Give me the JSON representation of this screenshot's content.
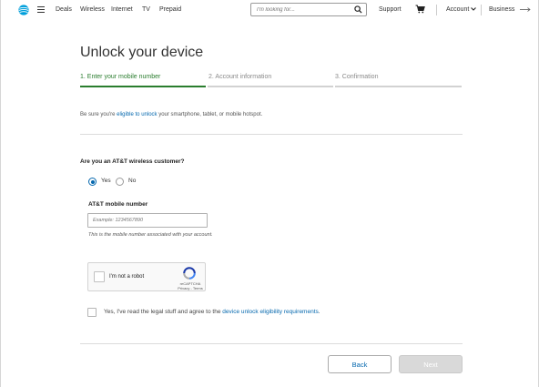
{
  "header": {
    "nav": [
      "Deals",
      "Wireless",
      "Internet",
      "TV",
      "Prepaid"
    ],
    "search_placeholder": "I'm looking for...",
    "support": "Support",
    "account": "Account",
    "business": "Business"
  },
  "page": {
    "title": "Unlock your device",
    "steps": [
      "1. Enter your mobile number",
      "2. Account information",
      "3. Confirmation"
    ],
    "active_step": 1,
    "intro_prefix": "Be sure you're ",
    "intro_link": "eligible to unlock",
    "intro_suffix": " your smartphone, tablet, or mobile hotspot."
  },
  "form": {
    "question": "Are you an AT&T wireless customer?",
    "yes_label": "Yes",
    "no_label": "No",
    "selected": "Yes",
    "number_label": "AT&T mobile number",
    "number_placeholder": "Example: 1234567890",
    "number_value": "",
    "helper": "This is the mobile number associated with your account.",
    "recaptcha_label": "I'm not a robot",
    "recaptcha_brand": "reCAPTCHA",
    "recaptcha_links": "Privacy - Terms",
    "agree_prefix": "Yes, I've read the legal stuff and agree to the ",
    "agree_link": "device unlock eligibility requirements",
    "agree_suffix": "."
  },
  "buttons": {
    "back": "Back",
    "next": "Next"
  },
  "colors": {
    "brand_blue": "#0568ae",
    "logo_blue": "#009fdb",
    "step_active": "#2a7d2e",
    "disabled": "#d9d9d9"
  }
}
